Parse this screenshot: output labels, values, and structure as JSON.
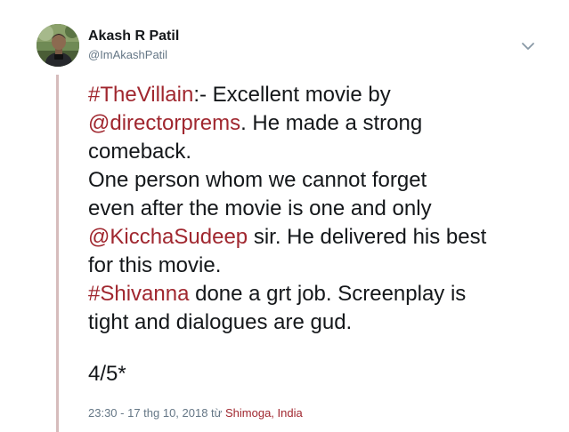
{
  "author": {
    "name": "Akash R Patil",
    "handle": "@ImAkashPatil"
  },
  "tweet": {
    "l1_tag": "#TheVillain",
    "l1_text": ":- Excellent movie by",
    "l2_mention": "@directorprems",
    "l2_text": ". He made a strong",
    "l3_text": "comeback.",
    "l4_text": "One person whom we cannot forget",
    "l5_text": "even after the movie is one and only",
    "l6_mention": "@KicchaSudeep",
    "l6_text": " sir. He delivered his best",
    "l7_text": "for this movie.",
    "l8_tag": "#Shivanna",
    "l8_text": " done a grt job. Screenplay is",
    "l9_text": "tight and dialogues are gud.",
    "rating": "4/5*"
  },
  "meta": {
    "timestamp": "23:30 - 17 thg 10, 2018 từ ",
    "place": "Shimoga, India"
  },
  "colors": {
    "link": "#a0272f",
    "thread_line": "#d6bcbc",
    "secondary_text": "#657786"
  },
  "icons": {
    "menu": "chevron-down-icon"
  }
}
